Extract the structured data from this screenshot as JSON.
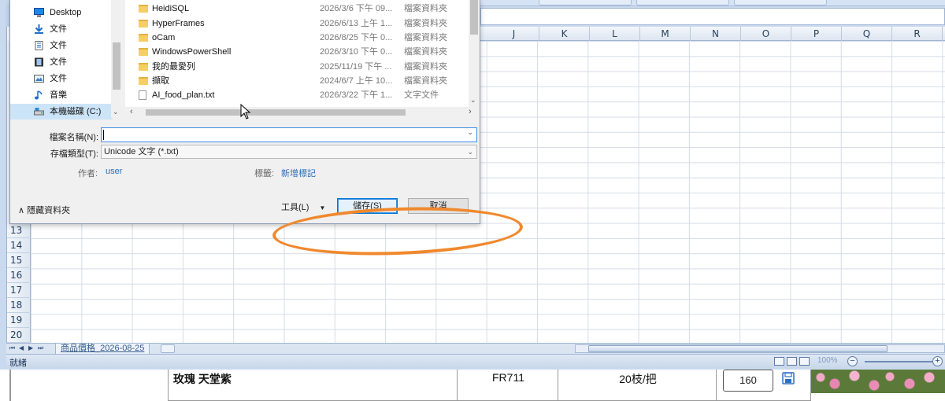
{
  "excel": {
    "columns": [
      "J",
      "K",
      "L",
      "M",
      "N",
      "O",
      "P",
      "Q",
      "R"
    ],
    "rows": [
      "13",
      "14",
      "15",
      "16",
      "17",
      "18",
      "19",
      "20"
    ],
    "sheet_tab": "商品價格_2026-08-25",
    "status": "就緒",
    "zoom": "100%"
  },
  "dialog": {
    "nav_items": [
      {
        "label": "Desktop",
        "icon": "desktop-icon"
      },
      {
        "label": "文件",
        "icon": "download-icon"
      },
      {
        "label": "文件",
        "icon": "document-icon"
      },
      {
        "label": "文件",
        "icon": "film-icon"
      },
      {
        "label": "文件",
        "icon": "picture-icon"
      },
      {
        "label": "音樂",
        "icon": "music-icon"
      },
      {
        "label": "本機磁碟 (C:)",
        "icon": "drive-icon"
      }
    ],
    "files": [
      {
        "name": "HeidiSQL",
        "date": "2026/3/6 下午 09...",
        "type": "檔案資料夾",
        "kind": "folder"
      },
      {
        "name": "HyperFrames",
        "date": "2026/6/13 上午 1...",
        "type": "檔案資料夾",
        "kind": "folder"
      },
      {
        "name": "oCam",
        "date": "2026/8/25 下午 0...",
        "type": "檔案資料夾",
        "kind": "folder"
      },
      {
        "name": "WindowsPowerShell",
        "date": "2026/3/10 下午 0...",
        "type": "檔案資料夾",
        "kind": "folder"
      },
      {
        "name": "我的最愛列",
        "date": "2025/11/19 下午 ...",
        "type": "檔案資料夾",
        "kind": "folder"
      },
      {
        "name": "擷取",
        "date": "2024/6/7 上午 10...",
        "type": "檔案資料夾",
        "kind": "folder"
      },
      {
        "name": "AI_food_plan.txt",
        "date": "2026/3/22 下午 1...",
        "type": "文字文件",
        "kind": "txt"
      }
    ],
    "filename_label": "檔案名稱(N):",
    "filename_value": "",
    "filetype_label": "存檔類型(T):",
    "filetype_value": "Unicode 文字 (*.txt)",
    "author_label": "作者:",
    "author_value": "user",
    "tags_label": "標籤:",
    "tags_value": "新增標記",
    "hide_folders": "隱藏資料夾",
    "tools": "工具(L)",
    "save": "儲存(S)",
    "cancel": "取消"
  },
  "webpage": {
    "product": "玫瑰 天堂紫",
    "code": "FR711",
    "unit": "20枝/把",
    "qty": "160"
  },
  "colors": {
    "annotation": "#f0882e",
    "accent": "#0078d7"
  }
}
